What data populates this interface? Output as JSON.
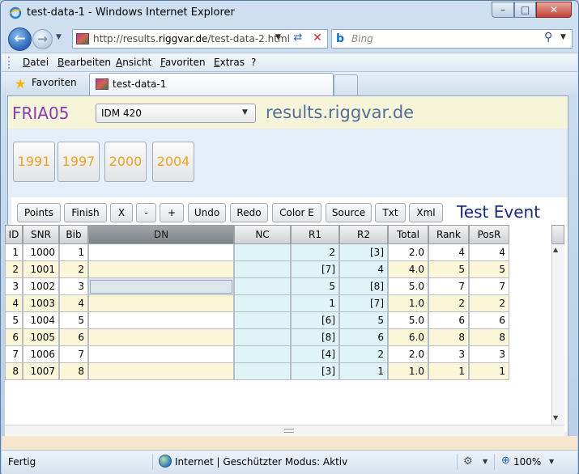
{
  "window": {
    "title": "test-data-1 - Windows Internet Explorer",
    "minimize_glyph": "–",
    "maximize_glyph": "□",
    "close_glyph": "✕"
  },
  "address_bar": {
    "url_prefix": "http://results.",
    "url_domain": "riggvar.de",
    "url_path": "/test-data-2.html"
  },
  "search": {
    "placeholder": "Bing"
  },
  "menu": [
    "Datei",
    "Bearbeiten",
    "Ansicht",
    "Favoriten",
    "Extras",
    "?"
  ],
  "favorites_bar": {
    "label": "Favoriten"
  },
  "tab": {
    "label": "test-data-1"
  },
  "page": {
    "event_code": "FRIA05",
    "event_select": "IDM 420",
    "site_title": "results.riggvar.de",
    "years": [
      "1991",
      "1997",
      "2000",
      "2004"
    ],
    "toolbar": [
      "Points",
      "Finish",
      "X",
      "-",
      "+",
      "Undo",
      "Redo",
      "Color E",
      "Source",
      "Txt",
      "Xml"
    ],
    "event_name": "Test Event",
    "columns": [
      "ID",
      "SNR",
      "Bib",
      "DN",
      "NC",
      "R1",
      "R2",
      "Total",
      "Rank",
      "PosR"
    ],
    "rows": [
      {
        "id": "1",
        "snr": "1000",
        "bib": "1",
        "dn": "",
        "nc": "",
        "r1": "2",
        "r2": "[3]",
        "total": "2.0",
        "rank": "4",
        "posr": "4"
      },
      {
        "id": "2",
        "snr": "1001",
        "bib": "2",
        "dn": "",
        "nc": "",
        "r1": "[7]",
        "r2": "4",
        "total": "4.0",
        "rank": "5",
        "posr": "5"
      },
      {
        "id": "3",
        "snr": "1002",
        "bib": "3",
        "dn": "",
        "nc": "",
        "r1": "5",
        "r2": "[8]",
        "total": "5.0",
        "rank": "7",
        "posr": "7"
      },
      {
        "id": "4",
        "snr": "1003",
        "bib": "4",
        "dn": "",
        "nc": "",
        "r1": "1",
        "r2": "[7]",
        "total": "1.0",
        "rank": "2",
        "posr": "2"
      },
      {
        "id": "5",
        "snr": "1004",
        "bib": "5",
        "dn": "",
        "nc": "",
        "r1": "[6]",
        "r2": "5",
        "total": "5.0",
        "rank": "6",
        "posr": "6"
      },
      {
        "id": "6",
        "snr": "1005",
        "bib": "6",
        "dn": "",
        "nc": "",
        "r1": "[8]",
        "r2": "6",
        "total": "6.0",
        "rank": "8",
        "posr": "8"
      },
      {
        "id": "7",
        "snr": "1006",
        "bib": "7",
        "dn": "",
        "nc": "",
        "r1": "[4]",
        "r2": "2",
        "total": "2.0",
        "rank": "3",
        "posr": "3"
      },
      {
        "id": "8",
        "snr": "1007",
        "bib": "8",
        "dn": "",
        "nc": "",
        "r1": "[3]",
        "r2": "1",
        "total": "1.0",
        "rank": "1",
        "posr": "1"
      }
    ]
  },
  "status_bar": {
    "text": "Fertig",
    "zone": "Internet | Geschützter Modus: Aktiv",
    "zoom": "100%"
  },
  "colors": {
    "event_code": "#8a3bb4",
    "site_title": "#526e9a",
    "year_text": "#f4a11f",
    "event_name": "#1a2a80",
    "row_yellow": "#fbf6d8",
    "cell_cyan": "#dff4f7"
  }
}
